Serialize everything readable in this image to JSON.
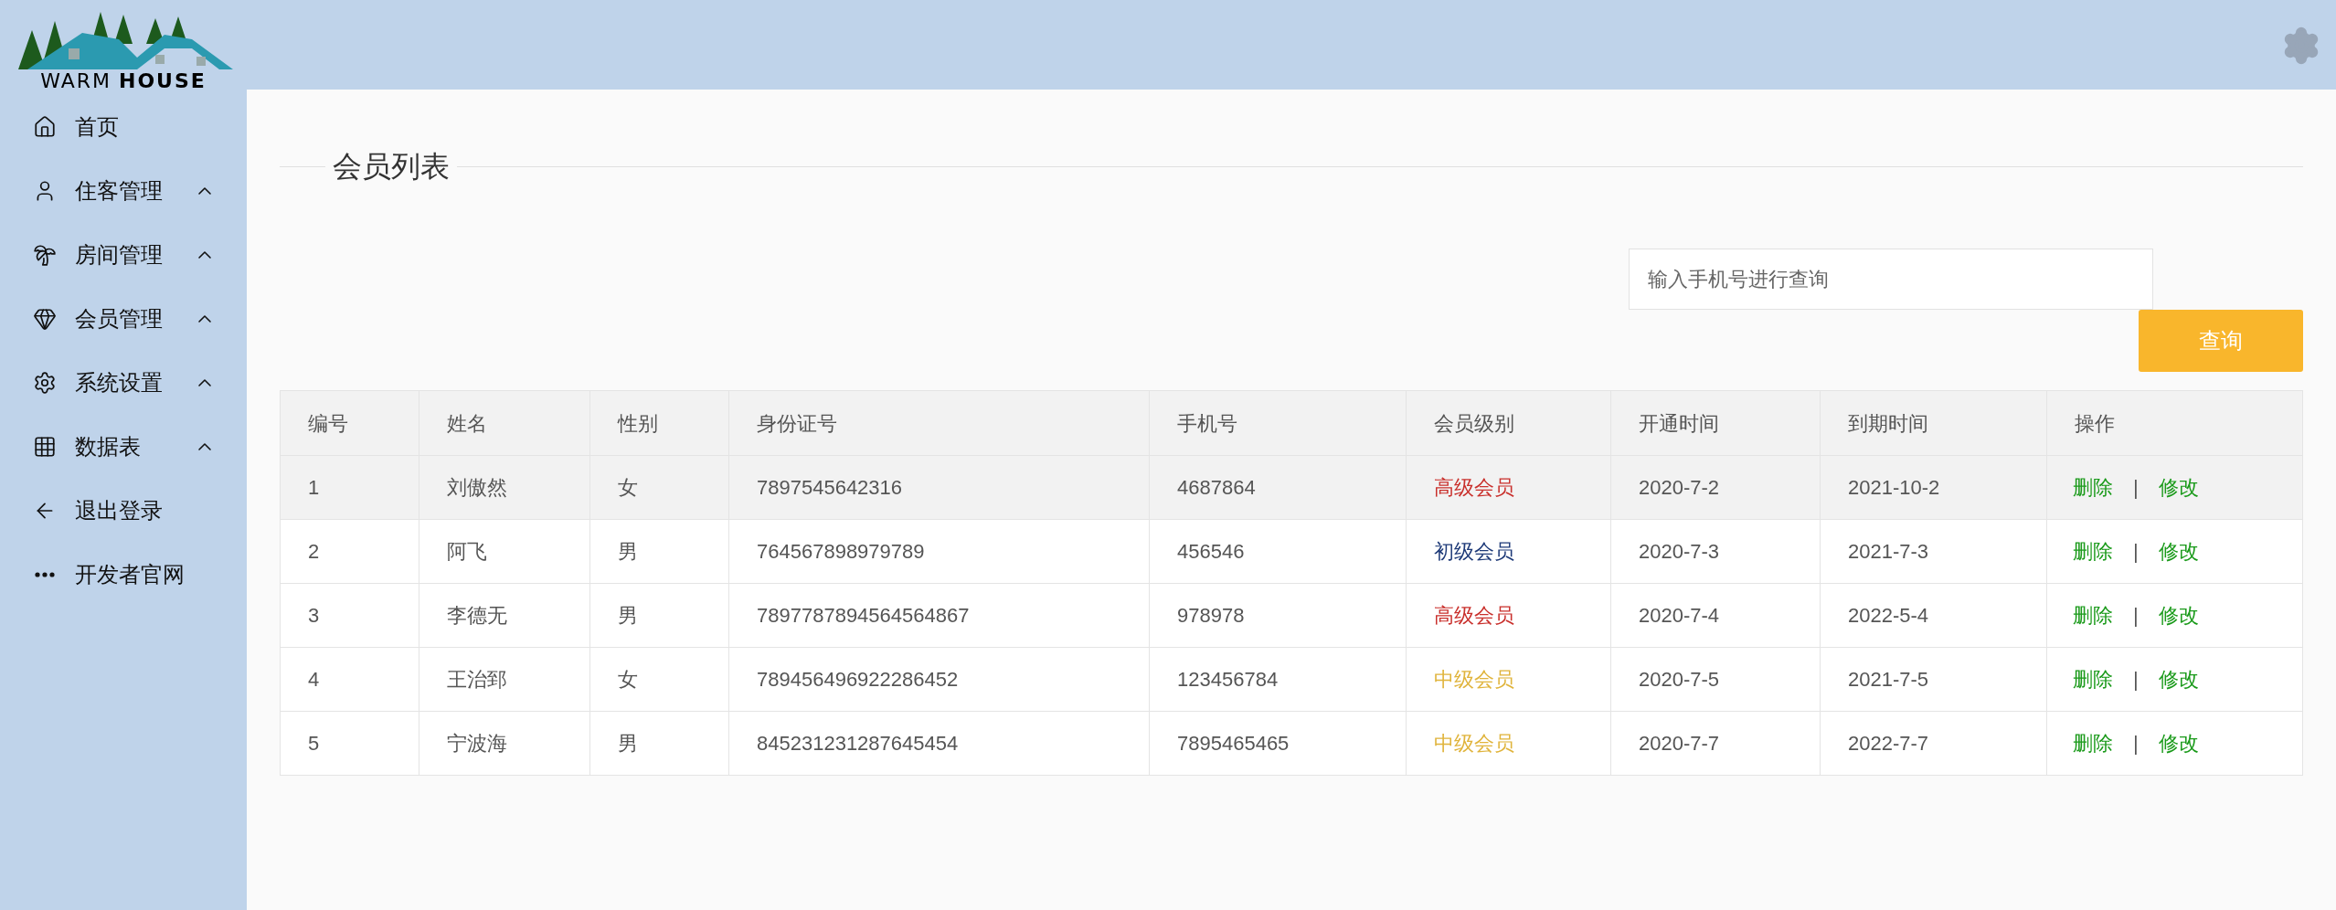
{
  "logo": {
    "text_1": "WARM",
    "text_2": "HOUSE"
  },
  "sidebar": {
    "items": [
      {
        "label": "首页",
        "kind": "link"
      },
      {
        "label": "住客管理",
        "kind": "group",
        "expanded": false
      },
      {
        "label": "房间管理",
        "kind": "group",
        "expanded": false
      },
      {
        "label": "会员管理",
        "kind": "group",
        "expanded": false
      },
      {
        "label": "系统设置",
        "kind": "group",
        "expanded": false
      },
      {
        "label": "数据表",
        "kind": "group",
        "expanded": false
      },
      {
        "label": "退出登录",
        "kind": "link"
      },
      {
        "label": "开发者官网",
        "kind": "link"
      }
    ]
  },
  "section_title": "会员列表",
  "search": {
    "placeholder": "输入手机号进行查询",
    "button": "查询"
  },
  "table": {
    "columns": [
      "编号",
      "姓名",
      "性别",
      "身份证号",
      "手机号",
      "会员级别",
      "开通时间",
      "到期时间",
      "操作"
    ],
    "rows": [
      {
        "selected": true,
        "cells": [
          "1",
          "刘傲然",
          "女",
          "7897545642316",
          "4687864"
        ],
        "level": {
          "text": "高级会员",
          "color": "#c9302c"
        },
        "opened": "2020-7-2",
        "expires": "2021-10-2",
        "actions": [
          "删除",
          "|",
          "修改"
        ]
      },
      {
        "selected": false,
        "cells": [
          "2",
          "阿飞",
          "男",
          "764567898979789",
          "456546"
        ],
        "level": {
          "text": "初级会员",
          "color": "#1e3a78"
        },
        "opened": "2020-7-3",
        "expires": "2021-7-3",
        "actions": [
          "删除",
          "|",
          "修改"
        ]
      },
      {
        "selected": false,
        "cells": [
          "3",
          "李德无",
          "男",
          "7897787894564564867",
          "978978"
        ],
        "level": {
          "text": "高级会员",
          "color": "#c9302c"
        },
        "opened": "2020-7-4",
        "expires": "2022-5-4",
        "actions": [
          "删除",
          "|",
          "修改"
        ]
      },
      {
        "selected": false,
        "cells": [
          "4",
          "王治郅",
          "女",
          "789456496922286452",
          "123456784"
        ],
        "level": {
          "text": "中级会员",
          "color": "#e0b43c"
        },
        "opened": "2020-7-5",
        "expires": "2021-7-5",
        "actions": [
          "删除",
          "|",
          "修改"
        ]
      },
      {
        "selected": false,
        "cells": [
          "5",
          "宁波海",
          "男",
          "845231231287645454",
          "7895465465"
        ],
        "level": {
          "text": "中级会员",
          "color": "#e0b43c"
        },
        "opened": "2020-7-7",
        "expires": "2022-7-7",
        "actions": [
          "删除",
          "|",
          "修改"
        ]
      }
    ]
  }
}
